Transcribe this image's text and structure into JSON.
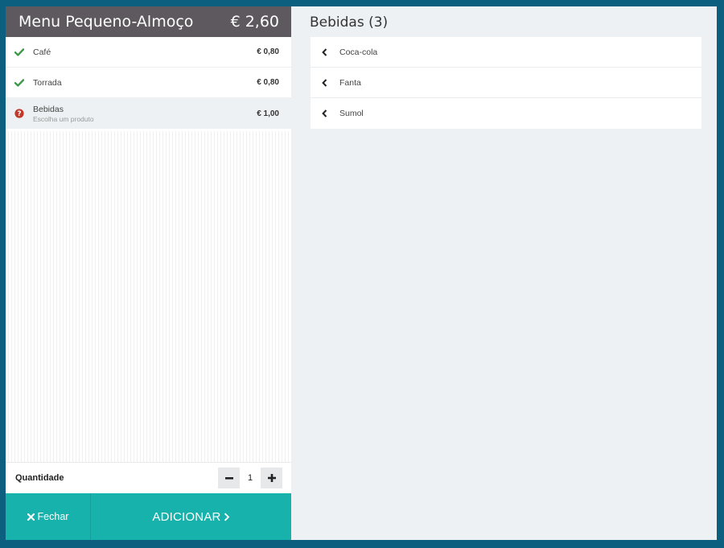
{
  "menu": {
    "title": "Menu Pequeno-Almoço",
    "total": "€ 2,60",
    "items": [
      {
        "name": "Café",
        "price": "€ 0,80",
        "status": "done"
      },
      {
        "name": "Torrada",
        "price": "€ 0,80",
        "status": "done"
      },
      {
        "name": "Bebidas",
        "subtitle": "Escolha um produto",
        "price": "€ 1,00",
        "status": "pending"
      }
    ]
  },
  "quantity": {
    "label": "Quantidade",
    "value": "1",
    "minus": "−",
    "plus": "+"
  },
  "actions": {
    "close_label": "Fechar",
    "add_label": "ADICIONAR"
  },
  "category": {
    "title": "Bebidas (3)",
    "products": [
      {
        "name": "Coca-cola"
      },
      {
        "name": "Fanta"
      },
      {
        "name": "Sumol"
      }
    ]
  },
  "colors": {
    "header_bg": "#5e595f",
    "accent": "#18b2ac",
    "check": "#3a9a4a",
    "warning": "#c0392b",
    "frame": "#0d5f80"
  },
  "icons": {
    "done": "check-icon",
    "pending": "question-circle-icon",
    "product": "chevron-left-icon",
    "close": "times-icon",
    "add": "chevron-right-icon"
  }
}
